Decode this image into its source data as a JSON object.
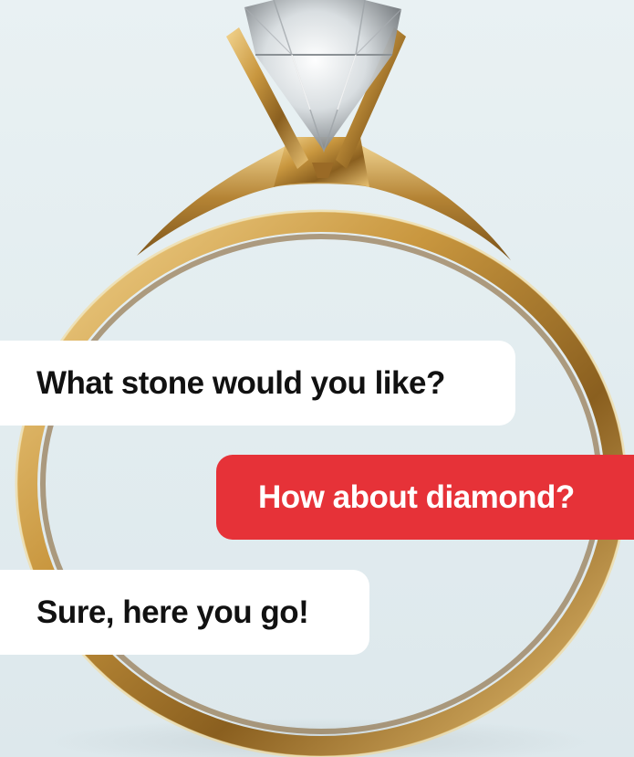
{
  "chat": {
    "messages": [
      {
        "side": "left",
        "text": "What stone would you like?"
      },
      {
        "side": "right",
        "text": "How about diamond?"
      },
      {
        "side": "left",
        "text": "Sure, here you go!"
      }
    ]
  },
  "colors": {
    "background": "#e6eff2",
    "bubble_white": "#ffffff",
    "bubble_red": "#e63238",
    "gold": "#b98a3c",
    "text_dark": "#111111"
  }
}
